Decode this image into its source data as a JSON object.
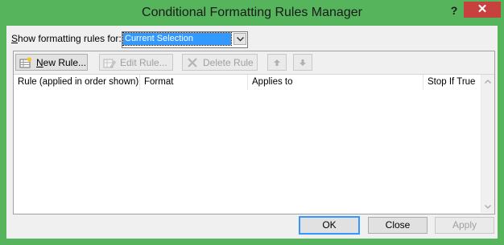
{
  "window": {
    "title": "Conditional Formatting Rules Manager",
    "help_glyph": "?",
    "close_glyph": "✕",
    "accent_color": "#56b45c"
  },
  "filter": {
    "label_prefix": "S",
    "label_rest": "how formatting rules for:",
    "selected": "Current Selection"
  },
  "toolbar": {
    "new_rule": "New Rule...",
    "new_rule_mnemonic": "N",
    "new_rule_rest": "ew Rule...",
    "edit_rule": "Edit Rule...",
    "delete_rule": "Delete Rule",
    "move_up_icon": "arrow-up-icon",
    "move_down_icon": "arrow-down-icon"
  },
  "table": {
    "columns": [
      "Rule (applied in order shown)",
      "Format",
      "Applies to",
      "Stop If True"
    ],
    "rows": []
  },
  "buttons": {
    "ok": "OK",
    "close": "Close",
    "apply": "Apply"
  }
}
